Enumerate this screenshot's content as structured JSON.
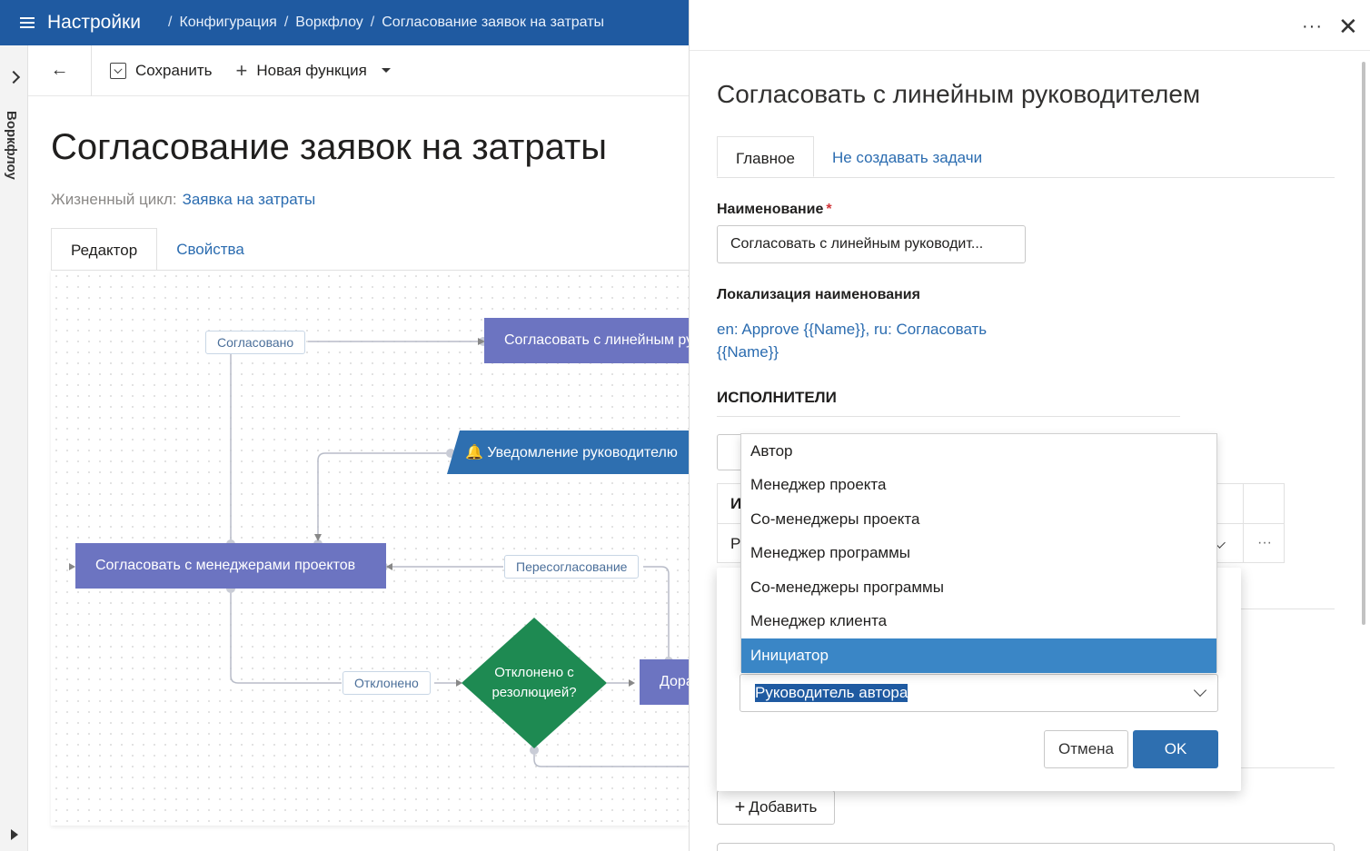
{
  "header": {
    "app_title": "Настройки",
    "breadcrumbs": [
      "Конфигурация",
      "Воркфлоу",
      "Согласование заявок на затраты"
    ],
    "sep": "/"
  },
  "rail": {
    "label": "Воркфлоу"
  },
  "toolbar": {
    "back": "←",
    "save_label": "Сохранить",
    "new_function_label": "Новая функция",
    "plus": "+"
  },
  "page": {
    "title": "Согласование заявок на затраты",
    "lifecycle_label": "Жизненный цикл:",
    "lifecycle_value": "Заявка на затраты",
    "tabs": [
      "Редактор",
      "Свойства"
    ]
  },
  "diagram": {
    "labels": {
      "approved": "Согласовано",
      "reapproval": "Пересогласование",
      "rejected": "Отклонено"
    },
    "nodes": {
      "approve_line_manager": "Согласовать с линейным руководителем",
      "notify_manager": "🔔 Уведомление руководителю",
      "approve_project_managers": "Согласовать с менеджерами проектов",
      "decision": [
        "Отклонено с",
        "резолюцией?"
      ],
      "rework": "Доработка"
    }
  },
  "panel": {
    "more": "···",
    "close": "✕",
    "title": "Согласовать с линейным руководителем",
    "tabs": [
      "Главное",
      "Не создавать задачи"
    ],
    "name_label": "Наименование",
    "required_mark": "*",
    "name_value": "Согласовать с линейным руководит...",
    "localization_label": "Локализация наименования",
    "localization_value": "en: Approve {{Name}}, ru: Согласовать {{Name}}",
    "performers_title": "ИСПОЛНИТЕЛИ",
    "table_header_initial": "И",
    "table_row_initial": "Р",
    "row_more": "···",
    "add_label": "Добавить"
  },
  "dialog": {
    "combo_value": "Руководитель автора",
    "cancel_label": "Отмена",
    "ok_label": "OK"
  },
  "dropdown": {
    "options": [
      "Автор",
      "Менеджер проекта",
      "Со-менеджеры проекта",
      "Менеджер программы",
      "Со-менеджеры программы",
      "Менеджер клиента",
      "Инициатор"
    ],
    "selected_index": 6
  },
  "colors": {
    "header_bg": "#1f5aa1",
    "task_node": "#6c74c1",
    "notify_node": "#2e6fb0",
    "decision_node": "#1e8a52",
    "link": "#2b6cb0",
    "selected_option": "#3a86c6",
    "primary_button": "#2e6fb0"
  }
}
